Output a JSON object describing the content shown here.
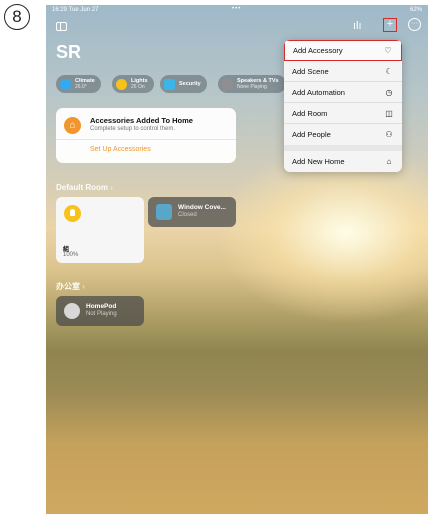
{
  "step_number": "8",
  "status_bar": {
    "time": "16:29  Tue Jun 27",
    "dots": "•••",
    "battery": "62%"
  },
  "header": {
    "home_title": "SR",
    "plus_glyph": "+",
    "more_glyph": "···"
  },
  "quick_pills": [
    {
      "label": "Climate",
      "sub": "26.0°",
      "icon_color": "#34aaf0"
    },
    {
      "label": "Lights",
      "sub": "26 On",
      "icon_color": "#f7c21b"
    },
    {
      "label": "Security",
      "sub": "",
      "icon_color": "#3cb4e6"
    },
    {
      "label": "Speakers & TVs",
      "sub": "None Playing",
      "icon_color": "#8e8e93"
    }
  ],
  "notice_card": {
    "title": "Accessories Added To Home",
    "subtitle": "Complete setup to control them.",
    "action": "Set Up Accessories",
    "accent": "#f0962c"
  },
  "rooms": [
    {
      "name": "Default Room",
      "chevron": "›"
    },
    {
      "name": "办公室",
      "chevron": "›"
    }
  ],
  "tiles": {
    "light": {
      "name": "組",
      "status": "100%"
    },
    "window": {
      "name": "Window Cove...",
      "status": "Closed"
    },
    "homepod": {
      "name": "HomePod",
      "status": "Not Playing"
    }
  },
  "menu": {
    "items": [
      {
        "label": "Add Accessory",
        "icon": "lightbulb-icon",
        "glyph": "♡"
      },
      {
        "label": "Add Scene",
        "icon": "scene-icon",
        "glyph": "☾"
      },
      {
        "label": "Add Automation",
        "icon": "automation-clock-icon",
        "glyph": "◷"
      },
      {
        "label": "Add Room",
        "icon": "room-icon",
        "glyph": "◫"
      },
      {
        "label": "Add People",
        "icon": "people-icon",
        "glyph": "⚇"
      },
      {
        "label": "Add New Home",
        "icon": "home-icon",
        "glyph": "⌂"
      }
    ]
  },
  "colors": {
    "highlight": "#d42a2a"
  }
}
